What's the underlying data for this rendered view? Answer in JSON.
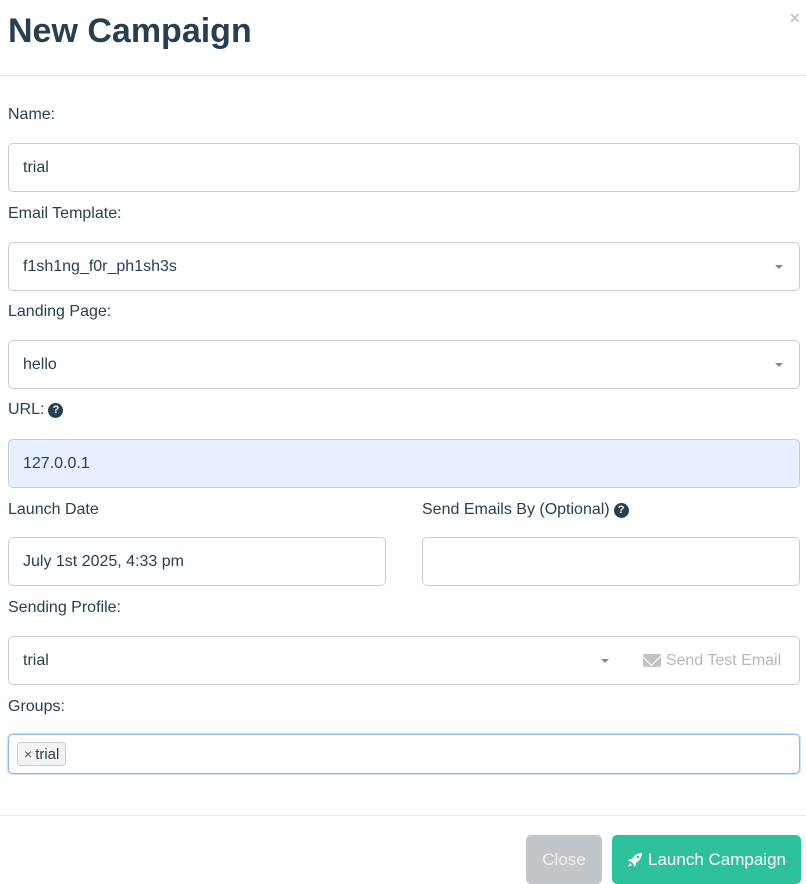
{
  "modal": {
    "title": "New Campaign",
    "close_symbol": "×"
  },
  "form": {
    "name": {
      "label": "Name:",
      "value": "trial"
    },
    "email_template": {
      "label": "Email Template:",
      "value": "f1sh1ng_f0r_ph1sh3s"
    },
    "landing_page": {
      "label": "Landing Page:",
      "value": "hello"
    },
    "url": {
      "label": "URL:",
      "help": "?",
      "value": "127.0.0.1"
    },
    "launch_date": {
      "label": "Launch Date",
      "value": "July 1st 2025, 4:33 pm"
    },
    "send_by": {
      "label": "Send Emails By (Optional)",
      "help": "?",
      "value": ""
    },
    "sending_profile": {
      "label": "Sending Profile:",
      "value": "trial",
      "test_email_label": "Send Test Email"
    },
    "groups": {
      "label": "Groups:",
      "tags": [
        {
          "remove": "×",
          "label": "trial"
        }
      ]
    }
  },
  "footer": {
    "close_label": "Close",
    "launch_label": "Launch Campaign"
  },
  "icons": {
    "help": "question-circle-icon",
    "envelope": "envelope-icon",
    "rocket": "rocket-icon"
  },
  "colors": {
    "title": "#283f50",
    "url_field_bg": "#e8f0fe",
    "launch_button": "#2dc29b",
    "close_button": "#c3c6c9"
  }
}
